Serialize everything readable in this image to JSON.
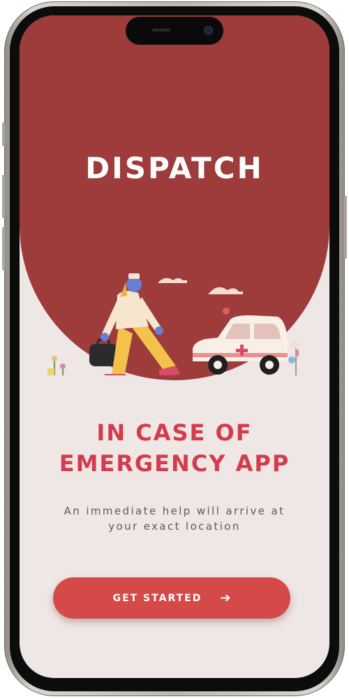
{
  "app": {
    "brand": "DISPATCH"
  },
  "onboarding": {
    "headline_line1": "IN CASE OF",
    "headline_line2": "EMERGENCY APP",
    "subtitle_line1": "An immediate help will arrive at",
    "subtitle_line2": "your exact location",
    "cta_label": "GET STARTED",
    "cta_icon": "arrow-right-icon"
  },
  "colors": {
    "hero_background": "#9e3b3b",
    "screen_background": "#eee7e6",
    "headline": "#d43b4b",
    "button": "#d54a48",
    "subtitle": "#5e5a5a"
  },
  "illustration": {
    "subject": "paramedic-with-ambulance-illustration"
  }
}
